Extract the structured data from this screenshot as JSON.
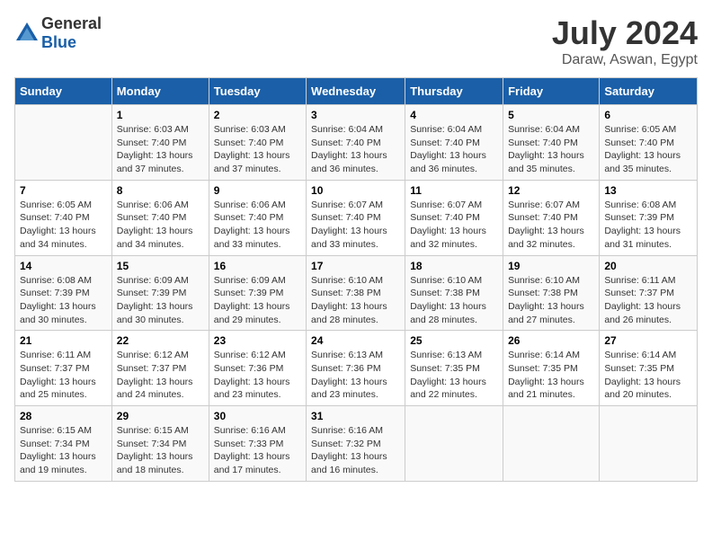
{
  "header": {
    "logo_general": "General",
    "logo_blue": "Blue",
    "title": "July 2024",
    "subtitle": "Daraw, Aswan, Egypt"
  },
  "columns": [
    "Sunday",
    "Monday",
    "Tuesday",
    "Wednesday",
    "Thursday",
    "Friday",
    "Saturday"
  ],
  "weeks": [
    [
      {
        "day": "",
        "info": ""
      },
      {
        "day": "1",
        "info": "Sunrise: 6:03 AM\nSunset: 7:40 PM\nDaylight: 13 hours and 37 minutes."
      },
      {
        "day": "2",
        "info": "Sunrise: 6:03 AM\nSunset: 7:40 PM\nDaylight: 13 hours and 37 minutes."
      },
      {
        "day": "3",
        "info": "Sunrise: 6:04 AM\nSunset: 7:40 PM\nDaylight: 13 hours and 36 minutes."
      },
      {
        "day": "4",
        "info": "Sunrise: 6:04 AM\nSunset: 7:40 PM\nDaylight: 13 hours and 36 minutes."
      },
      {
        "day": "5",
        "info": "Sunrise: 6:04 AM\nSunset: 7:40 PM\nDaylight: 13 hours and 35 minutes."
      },
      {
        "day": "6",
        "info": "Sunrise: 6:05 AM\nSunset: 7:40 PM\nDaylight: 13 hours and 35 minutes."
      }
    ],
    [
      {
        "day": "7",
        "info": "Sunrise: 6:05 AM\nSunset: 7:40 PM\nDaylight: 13 hours and 34 minutes."
      },
      {
        "day": "8",
        "info": "Sunrise: 6:06 AM\nSunset: 7:40 PM\nDaylight: 13 hours and 34 minutes."
      },
      {
        "day": "9",
        "info": "Sunrise: 6:06 AM\nSunset: 7:40 PM\nDaylight: 13 hours and 33 minutes."
      },
      {
        "day": "10",
        "info": "Sunrise: 6:07 AM\nSunset: 7:40 PM\nDaylight: 13 hours and 33 minutes."
      },
      {
        "day": "11",
        "info": "Sunrise: 6:07 AM\nSunset: 7:40 PM\nDaylight: 13 hours and 32 minutes."
      },
      {
        "day": "12",
        "info": "Sunrise: 6:07 AM\nSunset: 7:40 PM\nDaylight: 13 hours and 32 minutes."
      },
      {
        "day": "13",
        "info": "Sunrise: 6:08 AM\nSunset: 7:39 PM\nDaylight: 13 hours and 31 minutes."
      }
    ],
    [
      {
        "day": "14",
        "info": "Sunrise: 6:08 AM\nSunset: 7:39 PM\nDaylight: 13 hours and 30 minutes."
      },
      {
        "day": "15",
        "info": "Sunrise: 6:09 AM\nSunset: 7:39 PM\nDaylight: 13 hours and 30 minutes."
      },
      {
        "day": "16",
        "info": "Sunrise: 6:09 AM\nSunset: 7:39 PM\nDaylight: 13 hours and 29 minutes."
      },
      {
        "day": "17",
        "info": "Sunrise: 6:10 AM\nSunset: 7:38 PM\nDaylight: 13 hours and 28 minutes."
      },
      {
        "day": "18",
        "info": "Sunrise: 6:10 AM\nSunset: 7:38 PM\nDaylight: 13 hours and 28 minutes."
      },
      {
        "day": "19",
        "info": "Sunrise: 6:10 AM\nSunset: 7:38 PM\nDaylight: 13 hours and 27 minutes."
      },
      {
        "day": "20",
        "info": "Sunrise: 6:11 AM\nSunset: 7:37 PM\nDaylight: 13 hours and 26 minutes."
      }
    ],
    [
      {
        "day": "21",
        "info": "Sunrise: 6:11 AM\nSunset: 7:37 PM\nDaylight: 13 hours and 25 minutes."
      },
      {
        "day": "22",
        "info": "Sunrise: 6:12 AM\nSunset: 7:37 PM\nDaylight: 13 hours and 24 minutes."
      },
      {
        "day": "23",
        "info": "Sunrise: 6:12 AM\nSunset: 7:36 PM\nDaylight: 13 hours and 23 minutes."
      },
      {
        "day": "24",
        "info": "Sunrise: 6:13 AM\nSunset: 7:36 PM\nDaylight: 13 hours and 23 minutes."
      },
      {
        "day": "25",
        "info": "Sunrise: 6:13 AM\nSunset: 7:35 PM\nDaylight: 13 hours and 22 minutes."
      },
      {
        "day": "26",
        "info": "Sunrise: 6:14 AM\nSunset: 7:35 PM\nDaylight: 13 hours and 21 minutes."
      },
      {
        "day": "27",
        "info": "Sunrise: 6:14 AM\nSunset: 7:35 PM\nDaylight: 13 hours and 20 minutes."
      }
    ],
    [
      {
        "day": "28",
        "info": "Sunrise: 6:15 AM\nSunset: 7:34 PM\nDaylight: 13 hours and 19 minutes."
      },
      {
        "day": "29",
        "info": "Sunrise: 6:15 AM\nSunset: 7:34 PM\nDaylight: 13 hours and 18 minutes."
      },
      {
        "day": "30",
        "info": "Sunrise: 6:16 AM\nSunset: 7:33 PM\nDaylight: 13 hours and 17 minutes."
      },
      {
        "day": "31",
        "info": "Sunrise: 6:16 AM\nSunset: 7:32 PM\nDaylight: 13 hours and 16 minutes."
      },
      {
        "day": "",
        "info": ""
      },
      {
        "day": "",
        "info": ""
      },
      {
        "day": "",
        "info": ""
      }
    ]
  ]
}
